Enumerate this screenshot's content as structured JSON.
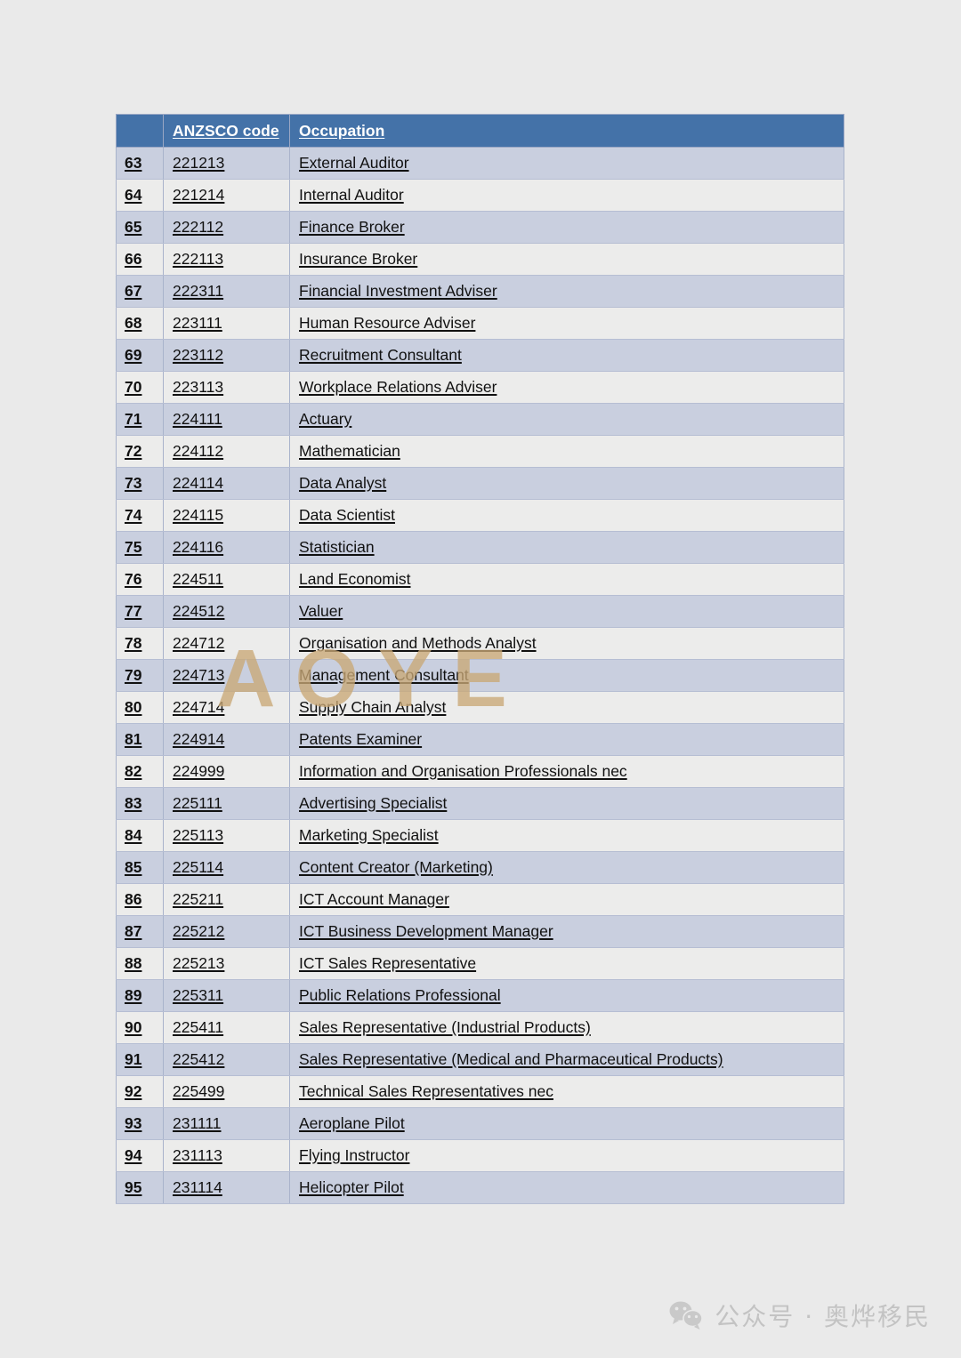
{
  "document": {
    "background_color": "#eaeaea",
    "watermark": {
      "text": "AOYE",
      "color": "#c9a876"
    }
  },
  "table": {
    "header": {
      "index_label": "",
      "code_label": "ANZSCO code",
      "occupation_label": "Occupation",
      "background_color": "#4472a8",
      "text_color": "#ffffff"
    },
    "row_colors": {
      "odd": "#c9cfdf",
      "even": "#ececeb"
    },
    "rows": [
      {
        "index": "63",
        "code": "221213",
        "occupation": "External Auditor"
      },
      {
        "index": "64",
        "code": "221214",
        "occupation": "Internal Auditor"
      },
      {
        "index": "65",
        "code": "222112",
        "occupation": "Finance Broker"
      },
      {
        "index": "66",
        "code": "222113",
        "occupation": "Insurance Broker"
      },
      {
        "index": "67",
        "code": "222311",
        "occupation": "Financial Investment Adviser"
      },
      {
        "index": "68",
        "code": "223111",
        "occupation": "Human Resource Adviser"
      },
      {
        "index": "69",
        "code": "223112",
        "occupation": "Recruitment Consultant"
      },
      {
        "index": "70",
        "code": "223113",
        "occupation": "Workplace Relations Adviser"
      },
      {
        "index": "71",
        "code": "224111",
        "occupation": "Actuary"
      },
      {
        "index": "72",
        "code": "224112",
        "occupation": "Mathematician"
      },
      {
        "index": "73",
        "code": "224114",
        "occupation": "Data Analyst"
      },
      {
        "index": "74",
        "code": "224115",
        "occupation": "Data Scientist"
      },
      {
        "index": "75",
        "code": "224116",
        "occupation": "Statistician"
      },
      {
        "index": "76",
        "code": "224511",
        "occupation": "Land Economist"
      },
      {
        "index": "77",
        "code": "224512",
        "occupation": "Valuer"
      },
      {
        "index": "78",
        "code": "224712",
        "occupation": "Organisation and Methods Analyst"
      },
      {
        "index": "79",
        "code": "224713",
        "occupation": "Management Consultant"
      },
      {
        "index": "80",
        "code": "224714",
        "occupation": "Supply Chain Analyst"
      },
      {
        "index": "81",
        "code": "224914",
        "occupation": "Patents Examiner"
      },
      {
        "index": "82",
        "code": "224999",
        "occupation": "Information and Organisation Professionals nec"
      },
      {
        "index": "83",
        "code": "225111",
        "occupation": "Advertising Specialist"
      },
      {
        "index": "84",
        "code": "225113",
        "occupation": "Marketing Specialist"
      },
      {
        "index": "85",
        "code": "225114",
        "occupation": "Content Creator (Marketing)"
      },
      {
        "index": "86",
        "code": "225211",
        "occupation": "ICT Account Manager"
      },
      {
        "index": "87",
        "code": "225212",
        "occupation": "ICT Business Development Manager"
      },
      {
        "index": "88",
        "code": "225213",
        "occupation": "ICT Sales Representative"
      },
      {
        "index": "89",
        "code": "225311",
        "occupation": "Public Relations Professional"
      },
      {
        "index": "90",
        "code": "225411",
        "occupation": "Sales Representative (Industrial Products)"
      },
      {
        "index": "91",
        "code": "225412",
        "occupation": "Sales Representative (Medical and Pharmaceutical Products)"
      },
      {
        "index": "92",
        "code": "225499",
        "occupation": "Technical Sales Representatives nec"
      },
      {
        "index": "93",
        "code": "231111",
        "occupation": "Aeroplane Pilot"
      },
      {
        "index": "94",
        "code": "231113",
        "occupation": "Flying Instructor"
      },
      {
        "index": "95",
        "code": "231114",
        "occupation": "Helicopter Pilot"
      }
    ]
  },
  "footer": {
    "icon": "wechat-icon",
    "brand_text": "公众号 · 奥烨移民",
    "text_color": "#c3c3c3"
  }
}
